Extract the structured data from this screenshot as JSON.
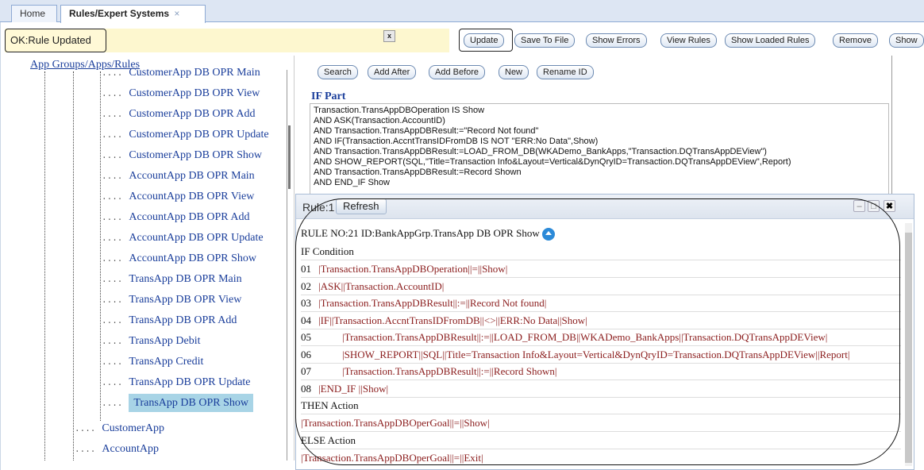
{
  "tabs": [
    {
      "label": "Home"
    },
    {
      "label": "Rules/Expert Systems",
      "close": "×"
    }
  ],
  "status": {
    "text": "OK:Rule Updated",
    "close": "x"
  },
  "toolbar": {
    "update": "Update",
    "save_to_file": "Save To File",
    "show_errors": "Show Errors",
    "view_rules": "View Rules",
    "show_loaded_rules": "Show Loaded Rules",
    "remove": "Remove",
    "show": "Show"
  },
  "tree": {
    "header": "App Groups/Apps/Rules",
    "items": [
      "CustomerApp DB OPR Main",
      "CustomerApp DB OPR View",
      "CustomerApp DB OPR Add",
      "CustomerApp DB OPR Update",
      "CustomerApp DB OPR Show",
      "AccountApp DB OPR Main",
      "AccountApp DB OPR View",
      "AccountApp DB OPR Add",
      "AccountApp DB OPR Update",
      "AccountApp DB OPR Show",
      "TransApp DB OPR Main",
      "TransApp DB OPR View",
      "TransApp DB OPR Add",
      "TransApp Debit",
      "TransApp Credit",
      "TransApp DB OPR Update",
      "TransApp DB OPR Show"
    ],
    "apps": [
      "CustomerApp",
      "AccountApp"
    ],
    "dash": "...."
  },
  "rule_toolbar": {
    "search": "Search",
    "add_after": "Add After",
    "add_before": "Add Before",
    "new": "New",
    "rename_id": "Rename ID"
  },
  "if_part": {
    "title": "IF Part",
    "text": "Transaction.TransAppDBOperation IS Show\nAND ASK(Transaction.AccountID)\nAND Transaction.TransAppDBResult:=\"Record Not found\"\nAND IF(Transaction.AccntTransIDFromDB IS NOT \"ERR:No Data\",Show)\nAND Transaction.TransAppDBResult:=LOAD_FROM_DB(WKADemo_BankApps,\"Transaction.DQTransAppDEView\")\nAND SHOW_REPORT(SQL,\"Title=Transaction Info&Layout=Vertical&DynQryID=Transaction.DQTransAppDEView\",Report)\nAND Transaction.TransAppDBResult:=Record Shown\nAND END_IF Show"
  },
  "dialog": {
    "title": "Rule:1",
    "refresh": "Refresh",
    "minimize": "–",
    "restore": "□",
    "close": "✖",
    "rule_header": "RULE NO:21 ID:BankAppGrp.TransApp DB OPR Show",
    "if_condition": "IF Condition",
    "then_action": "THEN Action",
    "else_action": "ELSE Action",
    "lines": [
      {
        "num": "01",
        "indent": false,
        "text": "|Transaction.TransAppDBOperation||=||Show|"
      },
      {
        "num": "02",
        "indent": false,
        "text": "|ASK||Transaction.AccountID|"
      },
      {
        "num": "03",
        "indent": false,
        "text": "|Transaction.TransAppDBResult||:=||Record Not found|"
      },
      {
        "num": "04",
        "indent": false,
        "text": "|IF||Transaction.AccntTransIDFromDB||<>||ERR:No Data||Show|"
      },
      {
        "num": "05",
        "indent": true,
        "text": "|Transaction.TransAppDBResult||:=||LOAD_FROM_DB||WKADemo_BankApps||Transaction.DQTransAppDEView|"
      },
      {
        "num": "06",
        "indent": true,
        "text": "|SHOW_REPORT||SQL||Title=Transaction Info&Layout=Vertical&DynQryID=Transaction.DQTransAppDEView||Report|"
      },
      {
        "num": "07",
        "indent": true,
        "text": "|Transaction.TransAppDBResult||:=||Record Shown|"
      },
      {
        "num": "08",
        "indent": false,
        "text": "|END_IF ||Show|"
      }
    ],
    "then_line": "|Transaction.TransAppDBOperGoal||=||Show|",
    "else_line": "|Transaction.TransAppDBOperGoal||=||Exit|"
  }
}
